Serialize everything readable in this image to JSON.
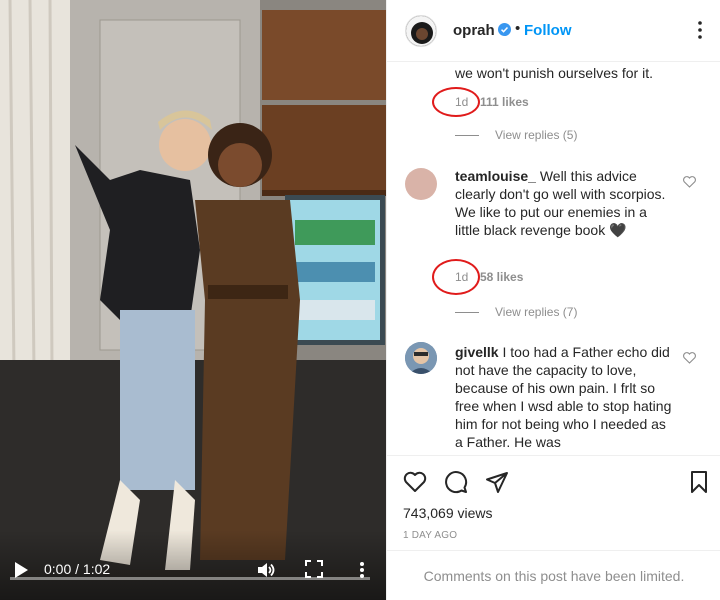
{
  "video": {
    "time_label": "0:00 / 1:02",
    "progress": 0.0
  },
  "header": {
    "username": "oprah",
    "dot": "•",
    "follow_label": "Follow"
  },
  "comments": {
    "first_fragment": "we won't punish ourselves for it.",
    "first_meta_age": "1d",
    "first_meta_likes": "111 likes",
    "first_view_replies": "View replies (5)",
    "items": [
      {
        "username": "teamlouise_",
        "text": "Well this advice clearly don't go well with scorpios. We like to put our enemies in a little black revenge book 🖤",
        "age": "1d",
        "likes": "58 likes",
        "view_replies": "View replies (7)"
      },
      {
        "username": "givellk",
        "text": "I too had a Father echo did not have the capacity to love, because of his own pain. I frlt so free when I wsd able to stop hating him for not being who I needed as a Father. He was"
      }
    ]
  },
  "stats": {
    "views": "743,069 views",
    "date": "1 DAY AGO"
  },
  "footer": {
    "limited_text": "Comments on this post have been limited."
  },
  "colors": {
    "accent": "#0095f6",
    "highlight": "#e01b1b",
    "muted": "#8e8e8e"
  }
}
